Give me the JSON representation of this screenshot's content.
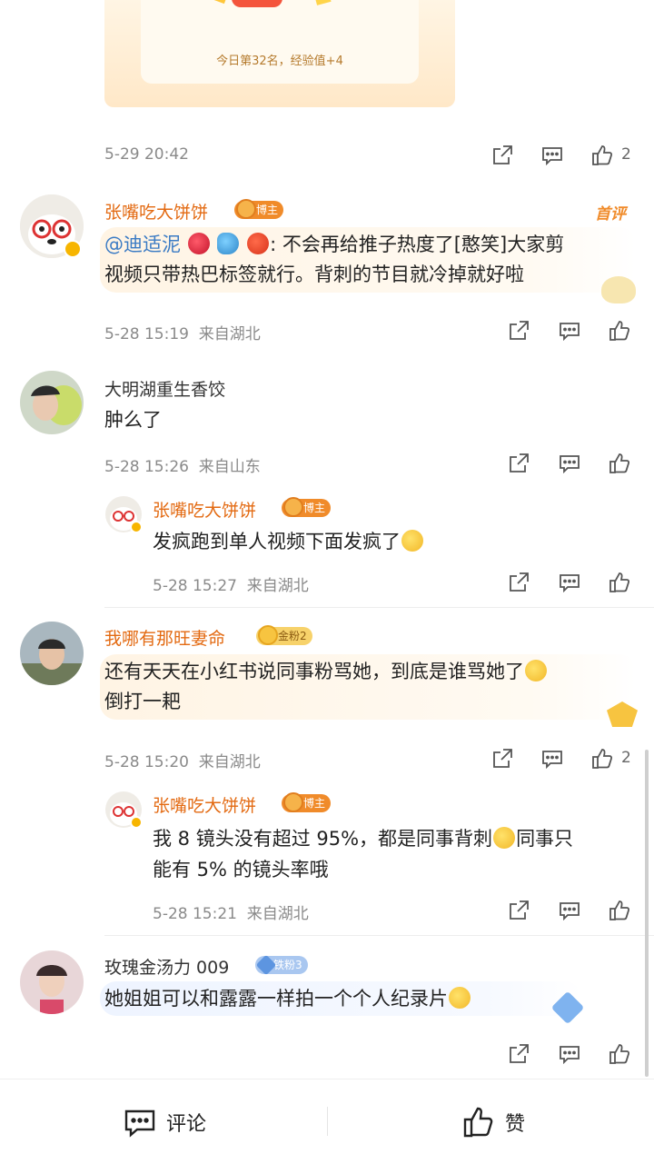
{
  "top_card": {
    "rank_text": "今日第32名，经验值+4"
  },
  "comments": [
    {
      "time": "5-29 20:42",
      "like_count": "2"
    },
    {
      "name": "张嘴吃大饼饼",
      "badge": "博主",
      "hot_tag": "首评",
      "mention": "@迪适泥",
      "text_line1": ": 不会再给推子热度了[憨笑]大家剪",
      "text_line2": "视频只带热巴标签就行。背刺的节目就冷掉就好啦",
      "time": "5-28 15:19",
      "location": "来自湖北"
    },
    {
      "name": "大明湖重生香饺",
      "text": "肿么了",
      "time": "5-28 15:26",
      "location": "来自山东",
      "reply": {
        "name": "张嘴吃大饼饼",
        "badge": "博主",
        "text": "发疯跑到单人视频下面发疯了",
        "time": "5-28 15:27",
        "location": "来自湖北"
      }
    },
    {
      "name": "我哪有那旺妻命",
      "badge": "金粉2",
      "text_line1": "还有天天在小红书说同事粉骂她，到底是谁骂她了",
      "text_line2": "倒打一耙",
      "time": "5-28 15:20",
      "location": "来自湖北",
      "like_count": "2",
      "reply": {
        "name": "张嘴吃大饼饼",
        "badge": "博主",
        "text_line1": "我 8 镜头没有超过 95%，都是同事背刺",
        "text_line1_end": "同事只",
        "text_line2": "能有 5% 的镜头率哦",
        "time": "5-28 15:21",
        "location": "来自湖北"
      }
    },
    {
      "name": "玫瑰金汤力 009",
      "badge": "铁粉3",
      "text": "她姐姐可以和露露一样拍一个个人纪录片"
    }
  ],
  "bottom_bar": {
    "comment_label": "评论",
    "like_label": "赞"
  },
  "colors": {
    "accent_orange": "#e36a12",
    "mention_blue": "#3b7bc4",
    "meta_gray": "#8a8a8a"
  }
}
